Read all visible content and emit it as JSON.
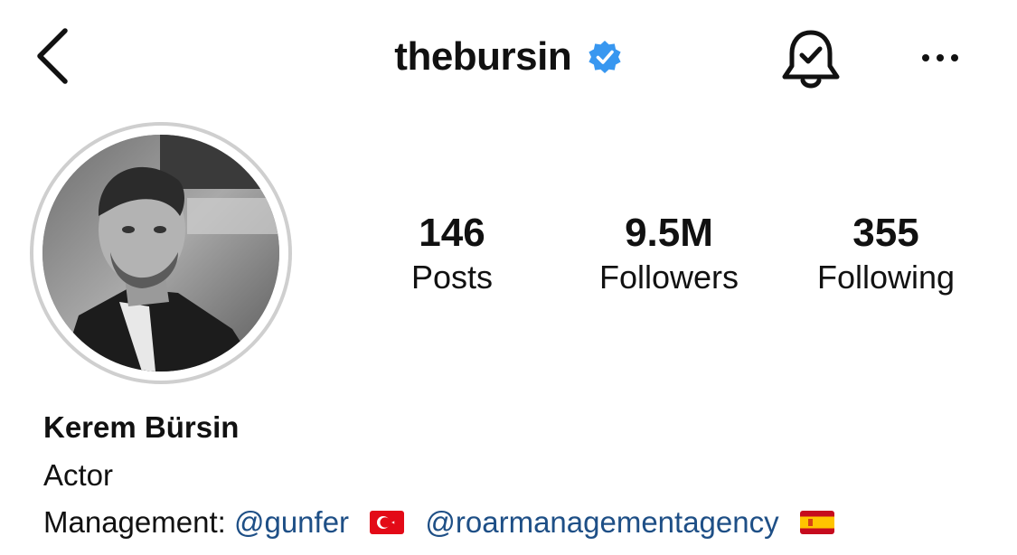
{
  "header": {
    "username": "thebursin",
    "icons": {
      "back": "chevron-left-icon",
      "verified": "verified-badge-icon",
      "notifications": "bell-check-icon",
      "more": "more-horizontal-icon"
    }
  },
  "stats": {
    "posts": {
      "value": "146",
      "label": "Posts"
    },
    "followers": {
      "value": "9.5M",
      "label": "Followers"
    },
    "following": {
      "value": "355",
      "label": "Following"
    }
  },
  "bio": {
    "full_name": "Kerem Bürsin",
    "category": "Actor",
    "management_prefix": "Management:",
    "mention_1": "@gunfer",
    "mention_2": "@roarmanagementagency"
  },
  "colors": {
    "text": "#111111",
    "link": "#1e4f86",
    "verified": "#3897f0",
    "ring": "#cfcfcf",
    "flag_tr": "#e30a17",
    "flag_es_red": "#c60b1e",
    "flag_es_yellow": "#ffc400"
  }
}
